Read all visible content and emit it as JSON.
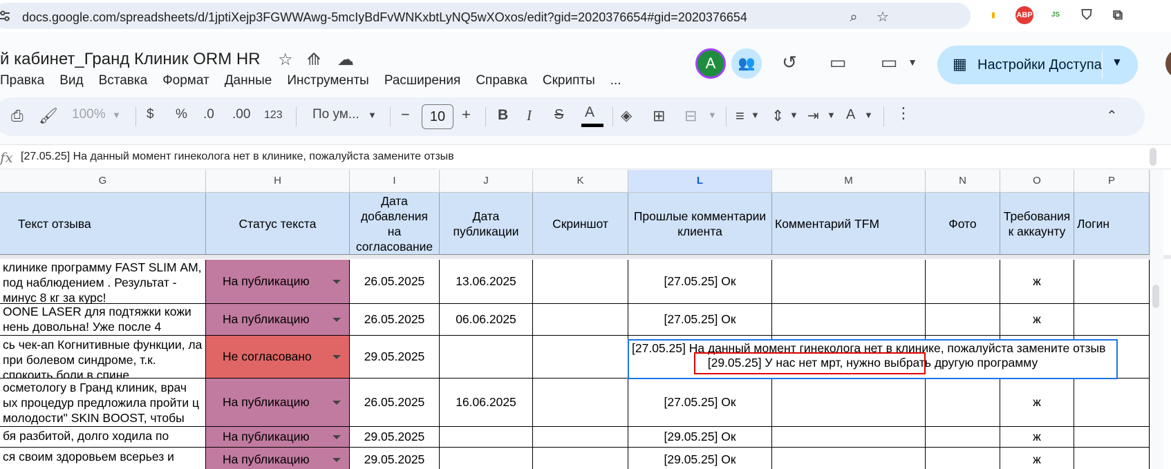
{
  "browser": {
    "url": "docs.google.com/spreadsheets/d/1jptiXejp3FGWWAwg-5mcIyBdFvWNKxbtLyNQ5wXOxos/edit?gid=2020376654#gid=2020376654",
    "ext_abp": "ABP",
    "ext_js": "JS"
  },
  "doc": {
    "title": "й кабинет_Гранд Клиник ORM HR",
    "avatar_letter": "A",
    "share_label": "Настройки Доступа"
  },
  "menu": [
    "Правка",
    "Вид",
    "Вставка",
    "Формат",
    "Данные",
    "Инструменты",
    "Расширения",
    "Справка",
    "Скрипты",
    "..."
  ],
  "toolbar": {
    "zoom": "100%",
    "currency": "$",
    "percent": "%",
    "dec_less": ".0",
    "dec_more": ".00",
    "number_format": "123",
    "font": "По ум...",
    "font_size": "10"
  },
  "formula_bar": {
    "fx": "fx",
    "content": "[27.05.25] На данный момент гинеколога нет в клинике, пожалуйста замените отзыв"
  },
  "columns": [
    "G",
    "H",
    "I",
    "J",
    "K",
    "L",
    "M",
    "N",
    "O",
    "P"
  ],
  "selected_column": "L",
  "headers": {
    "g": "Текст отзыва",
    "h": "Статус текста",
    "i": "Дата добавления на согласование",
    "j": "Дата публикации",
    "k": "Скриншот",
    "l": "Прошлые комментарии клиента",
    "m": "Комментарий TFM",
    "n": "Фото",
    "o": "Требования к аккаунту",
    "p": "Логин"
  },
  "rows": [
    {
      "text": "клинике программу FAST SLIM АМ, под наблюдением . Результат - минус 8 кг за курс!",
      "status": "На публикацию",
      "added": "26.05.2025",
      "published": "13.06.2025",
      "comment": "[27.05.25] Ок",
      "req": "ж"
    },
    {
      "text": "OONE LASER для подтяжки кожи нень довольна! Уже после 4",
      "status": "На публикацию",
      "added": "26.05.2025",
      "published": "06.06.2025",
      "comment": "[27.05.25] Ок",
      "req": "ж"
    },
    {
      "text": "сь чек-ап Когнитивные функции, ла при болевом синдроме, т.к. спокоить боли в спине.",
      "status": "Не согласовано",
      "added": "29.05.2025",
      "published": "",
      "comment": "",
      "req": ""
    },
    {
      "text": "осметологу в Гранд клиник,  врач ых процедур предложила пройти ц молодости\" SKIN BOOST, чтобы",
      "status": "На публикацию",
      "added": "26.05.2025",
      "published": "16.06.2025",
      "comment": "[27.05.25] Ок",
      "req": "ж"
    },
    {
      "text": "бя разбитой, долго ходила по",
      "status": "На публикацию",
      "added": "29.05.2025",
      "published": "",
      "comment": "[29.05.25] Ок",
      "req": "ж"
    },
    {
      "text": "ся своим здоровьем всерьез и",
      "status": "На публикацию",
      "added": "29.05.2025",
      "published": "",
      "comment": "[29.05.25] Ок",
      "req": "ж"
    }
  ],
  "active_cell": {
    "line1": "[27.05.25] На данный момент гинеколога нет в клинике, пожалуйста замените отзыв",
    "line2": "[29.05.25] У нас нет мрт, нужно выбрать другую программу"
  },
  "colors": {
    "status_publish": "#c27ba0",
    "status_rejected": "#e06666",
    "header_fill": "#cfe2f8",
    "share_button": "#c2e7ff",
    "highlight_box": "#e00000"
  }
}
